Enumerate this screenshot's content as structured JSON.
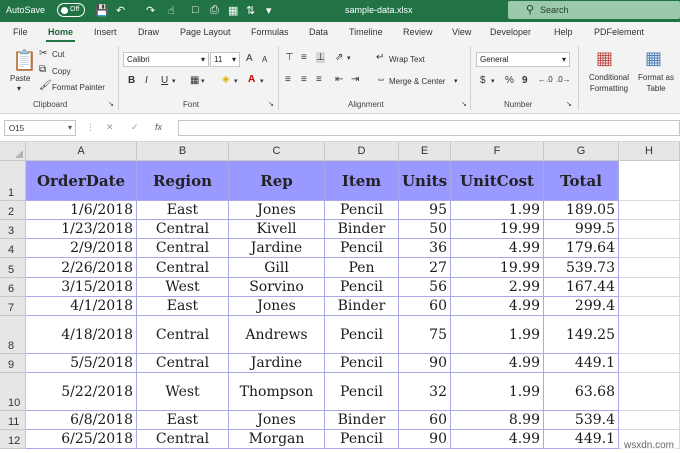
{
  "titlebar": {
    "autosave_label": "AutoSave",
    "autosave_state": "Off",
    "filename": "sample-data.xlsx",
    "search_placeholder": "Search"
  },
  "tabs": [
    "File",
    "Home",
    "Insert",
    "Draw",
    "Page Layout",
    "Formulas",
    "Data",
    "Timeline",
    "Review",
    "View",
    "Developer",
    "Help",
    "PDFelement"
  ],
  "active_tab": "Home",
  "ribbon": {
    "clipboard": {
      "paste": "Paste",
      "cut": "Cut",
      "copy": "Copy",
      "format_painter": "Format Painter",
      "label": "Clipboard"
    },
    "font": {
      "name": "Calibri",
      "size": "11",
      "bold": "B",
      "italic": "I",
      "underline": "U",
      "grow": "A",
      "shrink": "A",
      "label": "Font"
    },
    "alignment": {
      "wrap_text": "Wrap Text",
      "merge_center": "Merge & Center",
      "label": "Alignment"
    },
    "number": {
      "format": "General",
      "currency": "$",
      "percent": "%",
      "comma": "9",
      "label": "Number"
    },
    "styles": {
      "conditional_formatting": "Conditional Formatting",
      "format_as_table": "Format as Table"
    }
  },
  "formula_bar": {
    "name_box": "O15",
    "value": ""
  },
  "columns": [
    "A",
    "B",
    "C",
    "D",
    "E",
    "F",
    "G",
    "H"
  ],
  "header_row": [
    "OrderDate",
    "Region",
    "Rep",
    "Item",
    "Units",
    "UnitCost",
    "Total"
  ],
  "rows": [
    [
      "1/6/2018",
      "East",
      "Jones",
      "Pencil",
      "95",
      "1.99",
      "189.05"
    ],
    [
      "1/23/2018",
      "Central",
      "Kivell",
      "Binder",
      "50",
      "19.99",
      "999.5"
    ],
    [
      "2/9/2018",
      "Central",
      "Jardine",
      "Pencil",
      "36",
      "4.99",
      "179.64"
    ],
    [
      "2/26/2018",
      "Central",
      "Gill",
      "Pen",
      "27",
      "19.99",
      "539.73"
    ],
    [
      "3/15/2018",
      "West",
      "Sorvino",
      "Pencil",
      "56",
      "2.99",
      "167.44"
    ],
    [
      "4/1/2018",
      "East",
      "Jones",
      "Binder",
      "60",
      "4.99",
      "299.4"
    ],
    [
      "4/18/2018",
      "Central",
      "Andrews",
      "Pencil",
      "75",
      "1.99",
      "149.25"
    ],
    [
      "5/5/2018",
      "Central",
      "Jardine",
      "Pencil",
      "90",
      "4.99",
      "449.1"
    ],
    [
      "5/22/2018",
      "West",
      "Thompson",
      "Pencil",
      "32",
      "1.99",
      "63.68"
    ],
    [
      "6/8/2018",
      "East",
      "Jones",
      "Binder",
      "60",
      "8.99",
      "539.4"
    ],
    [
      "6/25/2018",
      "Central",
      "Morgan",
      "Pencil",
      "90",
      "4.99",
      "449.1"
    ]
  ],
  "row_numbers": [
    "1",
    "2",
    "3",
    "4",
    "5",
    "6",
    "7",
    "8",
    "9",
    "10",
    "11",
    "12"
  ],
  "watermark": "wsxdn.com"
}
